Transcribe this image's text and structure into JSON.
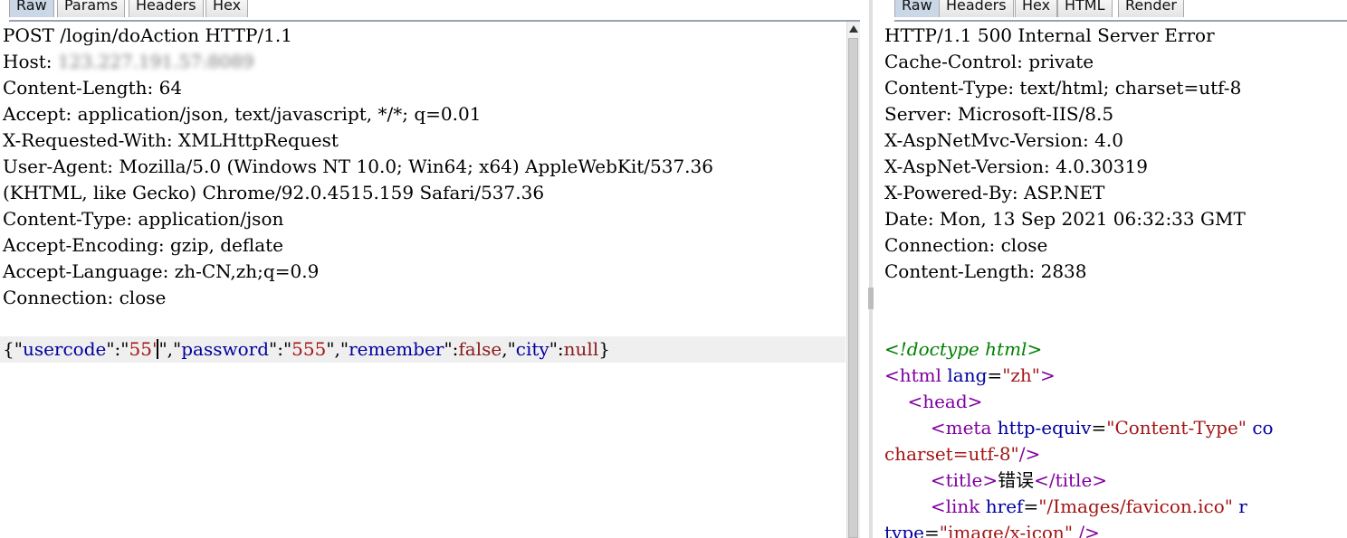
{
  "request": {
    "tabs": [
      "Raw",
      "Params",
      "Headers",
      "Hex"
    ],
    "active_tab": "Raw",
    "request_line": "POST /login/doAction HTTP/1.1",
    "host_label": "Host: ",
    "host_value_redacted": "123.227.191.57:8089",
    "headers": [
      "Content-Length: 64",
      "Accept: application/json, text/javascript, */*; q=0.01",
      "X-Requested-With: XMLHttpRequest",
      "User-Agent: Mozilla/5.0 (Windows NT 10.0; Win64; x64) AppleWebKit/537.36",
      "(KHTML, like Gecko) Chrome/92.0.4515.159 Safari/537.36",
      "Content-Type: application/json",
      "Accept-Encoding: gzip, deflate",
      "Accept-Language: zh-CN,zh;q=0.9",
      "Connection: close"
    ],
    "body": {
      "p1": "{\"",
      "k1": "usercode",
      "p2": "\":\"",
      "v1": "55'",
      "p3": "\",\"",
      "k2": "password",
      "p4": "\":\"",
      "v2": "555",
      "p5": "\",\"",
      "k3": "remember",
      "p6": "\":",
      "v3": "false",
      "p7": ",\"",
      "k4": "city",
      "p8": "\":",
      "v4": "null",
      "p9": "}"
    }
  },
  "response": {
    "tabs": [
      "Raw",
      "Headers",
      "Hex",
      "HTML",
      "Render"
    ],
    "active_tab": "Raw",
    "headers": [
      "HTTP/1.1 500 Internal Server Error",
      "Cache-Control: private",
      "Content-Type: text/html; charset=utf-8",
      "Server: Microsoft-IIS/8.5",
      "X-AspNetMvc-Version: 4.0",
      "X-AspNet-Version: 4.0.30319",
      "X-Powered-By: ASP.NET",
      "Date: Mon, 13 Sep 2021 06:32:33 GMT",
      "Connection: close",
      "Content-Length: 2838"
    ],
    "html": {
      "doctype": "<!doctype html>",
      "html_open": "<html",
      "lang_attr": " lang",
      "eq1": "=",
      "lang_val": "\"zh\"",
      "gt1": ">",
      "indent1": "    ",
      "head_tag": "<head>",
      "indent2": "        ",
      "meta_open": "<meta",
      "meta_attr": " http-equiv",
      "eq2": "=",
      "meta_val": "\"Content-Type\"",
      "meta_rest": " co",
      "charset_val": "charset=utf-8\"",
      "meta_close": "/>",
      "indent3": "        ",
      "title_open": "<title>",
      "title_text": "错误",
      "title_close": "</title>",
      "indent4": "        ",
      "link_open": "<link",
      "href_attr": " href",
      "eq3": "=",
      "href_val": "\"/Images/favicon.ico\"",
      "link_rest": " r",
      "type_attr": "type",
      "eq4": "=",
      "type_val": "\"image/x-icon\"",
      "link_close": " />"
    }
  }
}
